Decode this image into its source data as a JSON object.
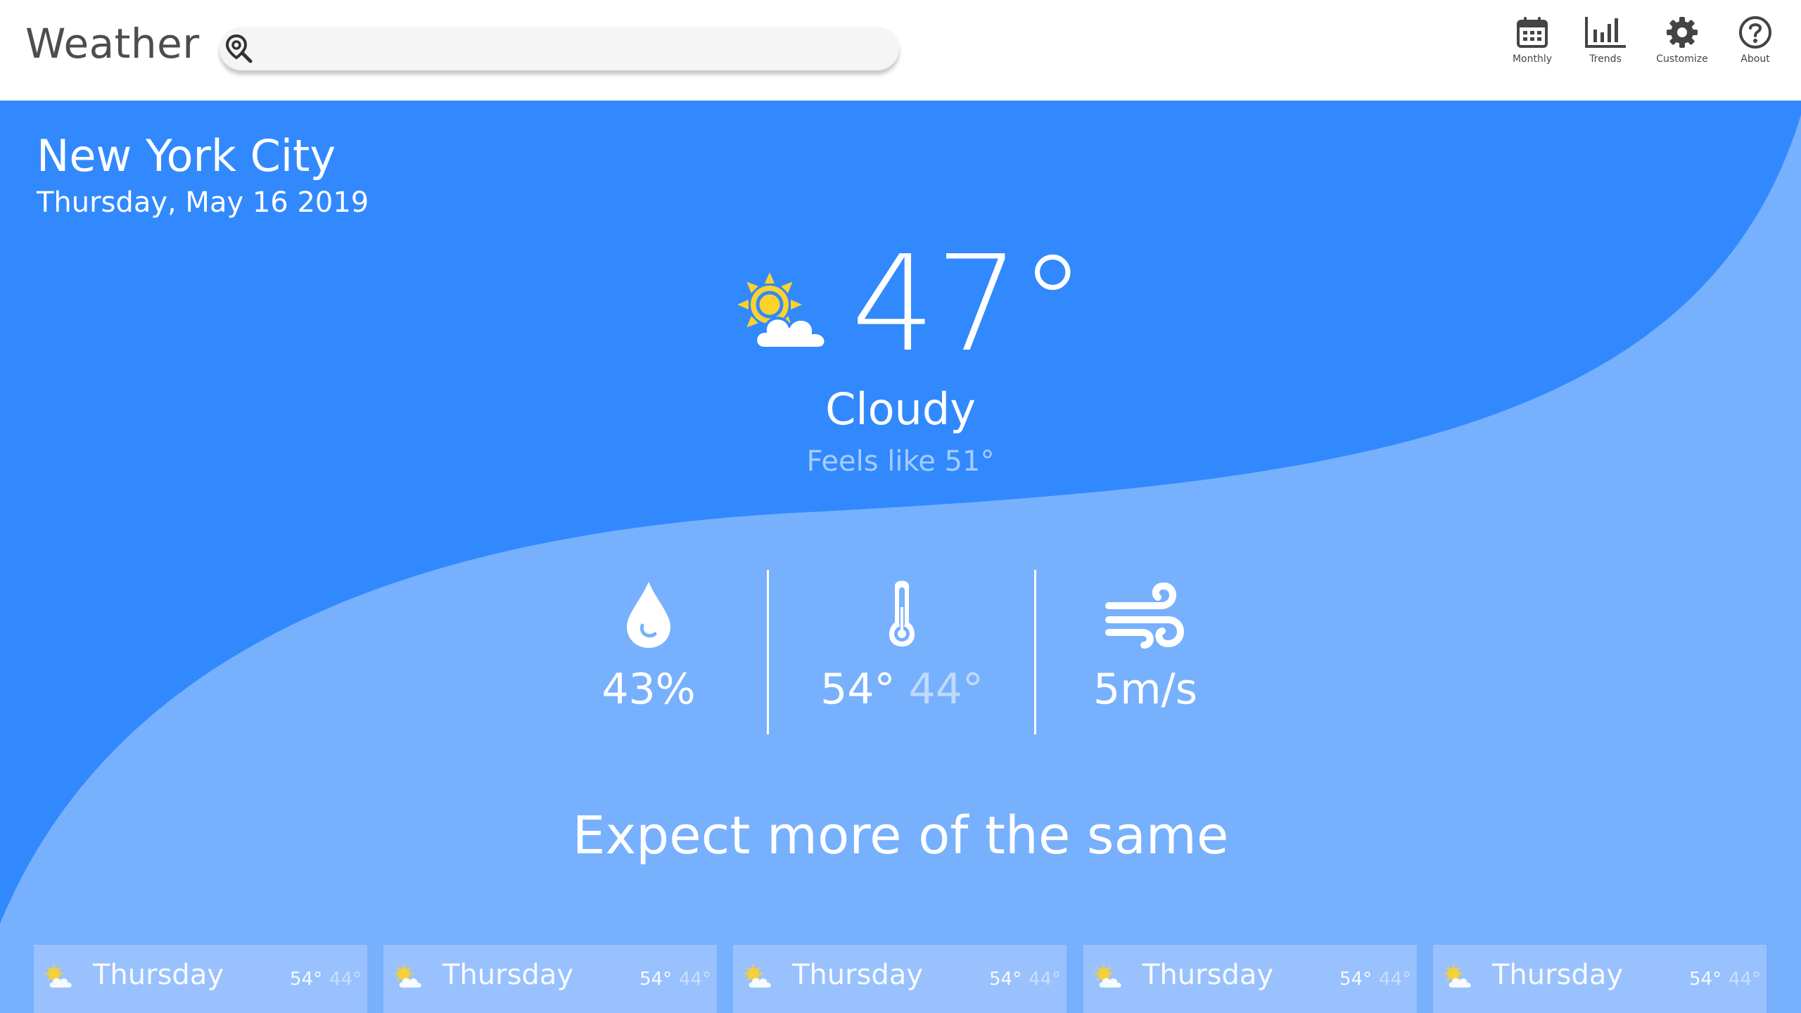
{
  "app": {
    "title": "Weather"
  },
  "search": {
    "placeholder": "",
    "value": ""
  },
  "nav": [
    {
      "label": "Monthly",
      "icon": "calendar-icon"
    },
    {
      "label": "Trends",
      "icon": "bar-chart-icon"
    },
    {
      "label": "Customize",
      "icon": "gear-icon"
    },
    {
      "label": "About",
      "icon": "help-icon"
    }
  ],
  "location": {
    "city": "New York City",
    "date": "Thursday, May 16 2019"
  },
  "current": {
    "temperature": "47°",
    "condition": "Cloudy",
    "feels_like": "Feels like 51°",
    "icon": "partly-cloudy-icon"
  },
  "stats": {
    "humidity": {
      "value": "43%",
      "icon": "droplet-icon"
    },
    "temp_range": {
      "high": "54°",
      "low": "44°",
      "icon": "thermometer-icon"
    },
    "wind": {
      "value": "5m/s",
      "icon": "wind-icon"
    }
  },
  "tagline": "Expect more of the same",
  "forecast": [
    {
      "day": "Thursday",
      "high": "54°",
      "low": "44°"
    },
    {
      "day": "Thursday",
      "high": "54°",
      "low": "44°"
    },
    {
      "day": "Thursday",
      "high": "54°",
      "low": "44°"
    },
    {
      "day": "Thursday",
      "high": "54°",
      "low": "44°"
    },
    {
      "day": "Thursday",
      "high": "54°",
      "low": "44°"
    }
  ],
  "colors": {
    "sky_dark": "#3189fd",
    "sky_light": "#77b0fd",
    "sun": "#fdd22d",
    "text_dark": "#4d4d4d"
  }
}
